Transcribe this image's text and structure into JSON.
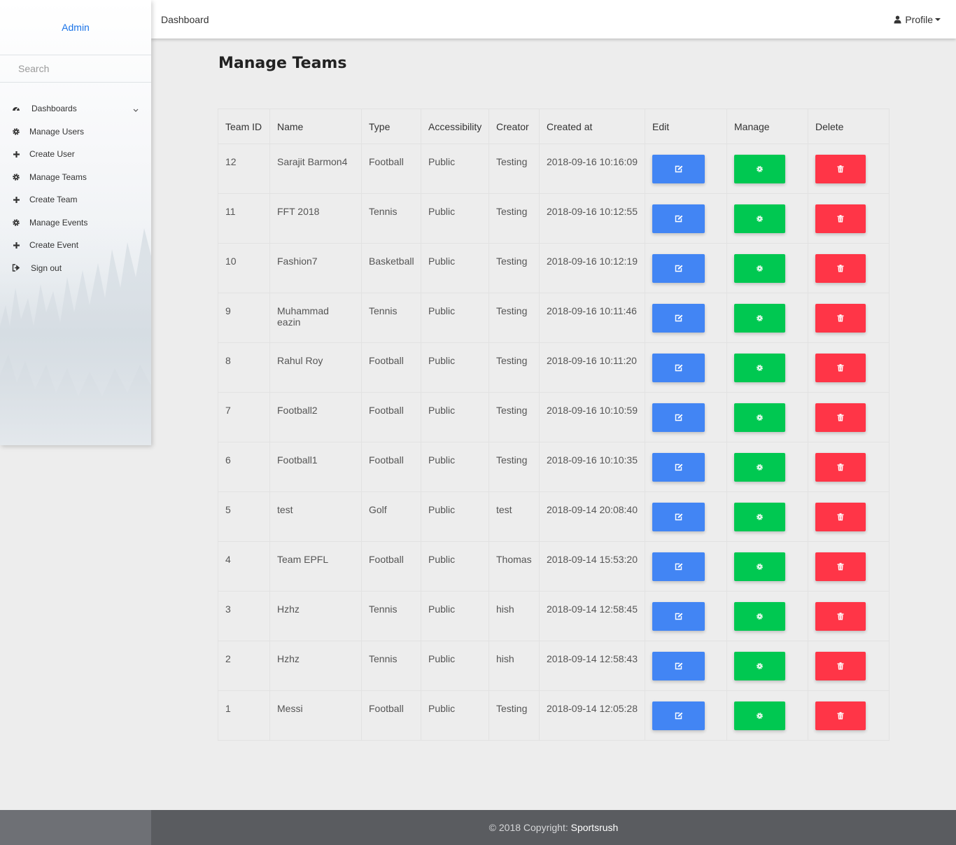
{
  "sidebar": {
    "brand": "Admin",
    "search_placeholder": "Search",
    "items": [
      {
        "label": "Dashboards",
        "icon": "dashboard-icon"
      },
      {
        "label": "Manage Users",
        "icon": "gear-icon"
      },
      {
        "label": "Create User",
        "icon": "plus-icon"
      },
      {
        "label": "Manage Teams",
        "icon": "gear-icon"
      },
      {
        "label": "Create Team",
        "icon": "plus-icon"
      },
      {
        "label": "Manage Events",
        "icon": "gear-icon"
      },
      {
        "label": "Create Event",
        "icon": "plus-icon"
      },
      {
        "label": "Sign out",
        "icon": "sign-out-icon"
      }
    ]
  },
  "topbar": {
    "breadcrumb": "Dashboard",
    "profile_label": "Profile"
  },
  "main": {
    "title": "Manage Teams",
    "columns": [
      "Team ID",
      "Name",
      "Type",
      "Accessibility",
      "Creator",
      "Created at",
      "Edit",
      "Manage",
      "Delete"
    ],
    "rows": [
      {
        "id": "12",
        "name": "Sarajit Barmon4",
        "type": "Football",
        "access": "Public",
        "creator": "Testing",
        "created": "2018-09-16 10:16:09"
      },
      {
        "id": "11",
        "name": "FFT 2018",
        "type": "Tennis",
        "access": "Public",
        "creator": "Testing",
        "created": "2018-09-16 10:12:55"
      },
      {
        "id": "10",
        "name": "Fashion7",
        "type": "Basketball",
        "access": "Public",
        "creator": "Testing",
        "created": "2018-09-16 10:12:19"
      },
      {
        "id": "9",
        "name": "Muhammad eazin",
        "type": "Tennis",
        "access": "Public",
        "creator": "Testing",
        "created": "2018-09-16 10:11:46"
      },
      {
        "id": "8",
        "name": "Rahul Roy",
        "type": "Football",
        "access": "Public",
        "creator": "Testing",
        "created": "2018-09-16 10:11:20"
      },
      {
        "id": "7",
        "name": "Football2",
        "type": "Football",
        "access": "Public",
        "creator": "Testing",
        "created": "2018-09-16 10:10:59"
      },
      {
        "id": "6",
        "name": "Football1",
        "type": "Football",
        "access": "Public",
        "creator": "Testing",
        "created": "2018-09-16 10:10:35"
      },
      {
        "id": "5",
        "name": "test",
        "type": "Golf",
        "access": "Public",
        "creator": "test",
        "created": "2018-09-14 20:08:40"
      },
      {
        "id": "4",
        "name": "Team EPFL",
        "type": "Football",
        "access": "Public",
        "creator": "Thomas",
        "created": "2018-09-14 15:53:20"
      },
      {
        "id": "3",
        "name": "Hzhz",
        "type": "Tennis",
        "access": "Public",
        "creator": "hish",
        "created": "2018-09-14 12:58:45"
      },
      {
        "id": "2",
        "name": "Hzhz",
        "type": "Tennis",
        "access": "Public",
        "creator": "hish",
        "created": "2018-09-14 12:58:43"
      },
      {
        "id": "1",
        "name": "Messi",
        "type": "Football",
        "access": "Public",
        "creator": "Testing",
        "created": "2018-09-14 12:05:28"
      }
    ],
    "action_icons": {
      "edit": "edit-icon",
      "manage": "gear-icon",
      "delete": "trash-icon"
    }
  },
  "footer": {
    "copyright": "© 2018 Copyright:",
    "brand": "Sportsrush"
  },
  "colors": {
    "accent": "#1a73e8",
    "edit": "#4285f4",
    "manage": "#00c851",
    "delete": "#ff3547",
    "footer": "#5a5c60"
  }
}
